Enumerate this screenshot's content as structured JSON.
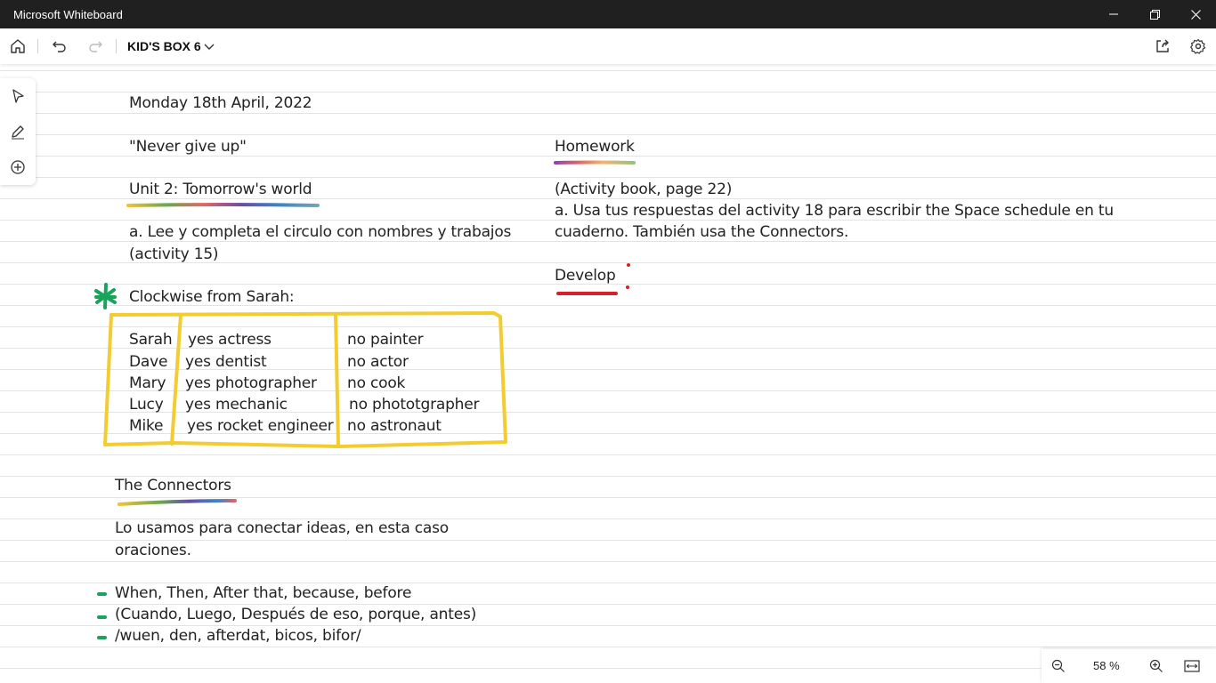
{
  "window": {
    "title": "Microsoft Whiteboard"
  },
  "toolbar": {
    "board_title": "KID'S BOX 6"
  },
  "board": {
    "date": "Monday 18th April, 2022",
    "motto": "\"Never  give up\"",
    "unit": "Unit 2: Tomorrow's world",
    "instruction_line1": "a. Lee y completa el circulo con nombres y trabajos",
    "instruction_line2": "(activity 15)",
    "clockwise": "Clockwise from Sarah:",
    "table": {
      "names": [
        "Sarah",
        "Dave",
        "Mary",
        "Lucy",
        "Mike"
      ],
      "yes": [
        "yes   actress",
        "yes  dentist",
        "yes  photographer",
        "yes  mechanic",
        "yes  rocket engineer"
      ],
      "no": [
        "no   painter",
        "no   actor",
        "no   cook",
        "no  phototgrapher",
        "no  astronaut"
      ]
    },
    "connectors_title": "The Connectors",
    "connectors_line1": "Lo usamos para conectar ideas, en esta caso",
    "connectors_line2": "oraciones.",
    "bullets": [
      "When, Then, After that, because, before",
      "(Cuando, Luego, Después de eso, porque, antes)",
      "/wuen, den, afterdat, bicos, bifor/"
    ],
    "homework_title": "Homework",
    "homework_ref": "(Activity book, page 22)",
    "homework_line1": "a. Usa tus respuestas del activity 18 para escribir the Space schedule en tu",
    "homework_line2": "cuaderno. También usa the Connectors.",
    "develop_title": "Develop"
  },
  "zoom": {
    "level": "58 %"
  },
  "colors": {
    "titlebar": "#202020",
    "table_outline": "#f2cc30",
    "green_mark": "#1aa35a",
    "develop_underline": "#d6202a"
  }
}
